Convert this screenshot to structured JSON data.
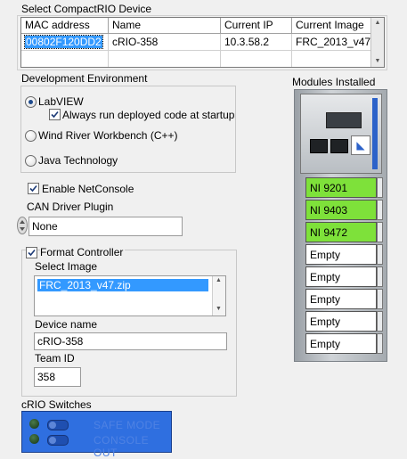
{
  "device_section": {
    "title": "Select CompactRIO Device",
    "columns": [
      "MAC address",
      "Name",
      "Current IP",
      "Current Image"
    ],
    "rows": [
      [
        "00802F120DD2",
        "cRIO-358",
        "10.3.58.2",
        "FRC_2013_v47"
      ]
    ]
  },
  "dev_env": {
    "title": "Development Environment",
    "options": [
      "LabVIEW",
      "Wind River Workbench (C++)",
      "Java Technology"
    ],
    "selected": "LabVIEW",
    "always_run_label": "Always run deployed code at startup",
    "always_run_checked": true
  },
  "modules": {
    "title": "Modules Installed",
    "slots": [
      "NI 9201",
      "NI 9403",
      "NI 9472",
      "Empty",
      "Empty",
      "Empty",
      "Empty",
      "Empty"
    ],
    "active_color": "#7ee13a"
  },
  "netconsole": {
    "label": "Enable NetConsole",
    "checked": true
  },
  "can_driver": {
    "label": "CAN Driver Plugin",
    "value": "None"
  },
  "format": {
    "label": "Format Controller",
    "checked": true,
    "select_image_label": "Select Image",
    "images": [
      "FRC_2013_v47.zip"
    ],
    "device_name_label": "Device name",
    "device_name": "cRIO-358",
    "team_id_label": "Team ID",
    "team_id": "358"
  },
  "switches": {
    "title": "cRIO Switches",
    "items": [
      "SAFE MODE",
      "CONSOLE OUT"
    ]
  }
}
